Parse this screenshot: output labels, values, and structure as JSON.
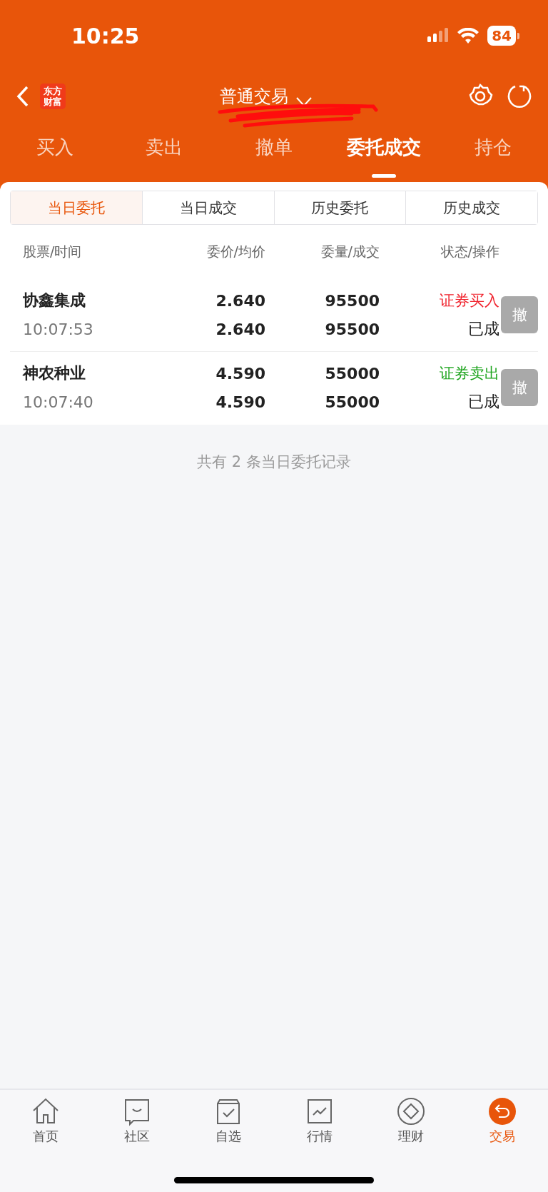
{
  "status_bar": {
    "time": "10:25",
    "battery": "84"
  },
  "nav": {
    "logo": [
      "东方",
      "财富"
    ],
    "title": "普通交易"
  },
  "tabs": [
    {
      "label": "买入",
      "selected": false
    },
    {
      "label": "卖出",
      "selected": false
    },
    {
      "label": "撤单",
      "selected": false
    },
    {
      "label": "委托成交",
      "selected": true
    },
    {
      "label": "持仓",
      "selected": false
    }
  ],
  "segments": [
    {
      "label": "当日委托",
      "selected": true
    },
    {
      "label": "当日成交",
      "selected": false
    },
    {
      "label": "历史委托",
      "selected": false
    },
    {
      "label": "历史成交",
      "selected": false
    }
  ],
  "table": {
    "columns": [
      "股票/时间",
      "委价/均价",
      "委量/成交",
      "状态/操作"
    ],
    "rows": [
      {
        "stock": "协鑫集成",
        "time": "10:07:53",
        "order_price": "2.640",
        "avg_price": "2.640",
        "order_qty": "95500",
        "filled_qty": "95500",
        "direction": "证券买入",
        "color": "#f0212b",
        "status": "已成",
        "action": "撤",
        "disabled": true
      },
      {
        "stock": "神农种业",
        "time": "10:07:40",
        "order_price": "4.590",
        "avg_price": "4.590",
        "order_qty": "55000",
        "filled_qty": "55000",
        "direction": "证券卖出",
        "color": "#1aa31a",
        "status": "已成",
        "action": "撤",
        "disabled": true
      }
    ]
  },
  "summary": "共有 2 条当日委托记录",
  "bottom_nav": [
    {
      "label": "首页",
      "kind": "home",
      "selected": false
    },
    {
      "label": "社区",
      "kind": "chat",
      "selected": false
    },
    {
      "label": "自选",
      "kind": "box",
      "selected": false
    },
    {
      "label": "行情",
      "kind": "chart",
      "selected": false
    },
    {
      "label": "理财",
      "kind": "diamond",
      "selected": false
    },
    {
      "label": "交易",
      "kind": "trade",
      "selected": true
    }
  ]
}
